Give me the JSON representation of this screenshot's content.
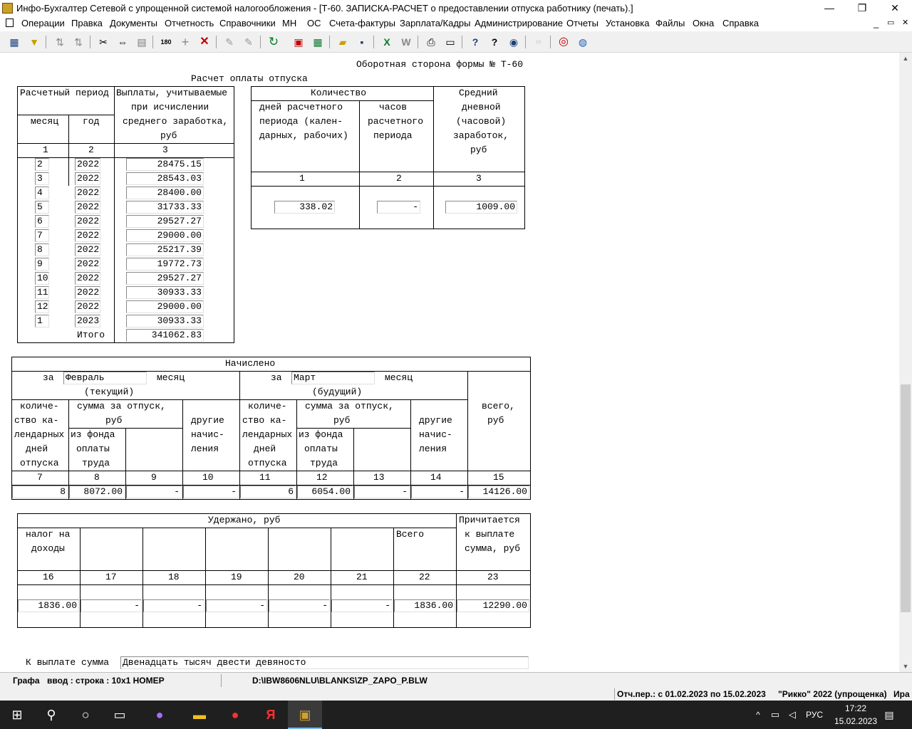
{
  "window": {
    "title": "Инфо-Бухгалтер Сетевой с упрощенной системой налогообложения - [Т-60. ЗАПИСКА-РАСЧЕТ о предоставлении отпуска работнику (печать).]",
    "minimize": "—",
    "restore": "❐",
    "close": "✕"
  },
  "menu": {
    "items": [
      "Операции",
      "Правка",
      "Документы",
      "Отчетность",
      "Справочники",
      "МН",
      "ОС",
      "Счета-фактуры",
      "Зарплата/Кадры",
      "Администрирование",
      "Отчеты",
      "Установка",
      "Файлы",
      "Окна",
      "Справка"
    ],
    "child_min": "_",
    "child_restore": "▭",
    "child_close": "✕"
  },
  "toolbar": {
    "icons": [
      "grid-icon",
      "filter-icon",
      "sort-asc-icon",
      "sort-desc-icon",
      "cut-icon",
      "swap-icon",
      "paste-icon",
      "number-180-icon",
      "add-icon",
      "delete-icon",
      "pin-icon",
      "pin-abc-icon",
      "refresh-icon",
      "calendar-icon",
      "calculator-icon",
      "open-folder-icon",
      "save-icon",
      "excel-icon",
      "word-icon",
      "print-icon",
      "print-preview-icon",
      "help-icon",
      "help-context-icon",
      "compass-icon",
      "report-icon",
      "lifebuoy-icon",
      "globe-icon"
    ]
  },
  "form": {
    "header": "Оборотная сторона формы № Т-60",
    "calc_title": "Расчет оплаты отпуска",
    "left_table": {
      "h_period": "Расчетный период",
      "h_payments": [
        "Выплаты, учитываемые",
        "при исчислении",
        "среднего заработка,",
        "руб"
      ],
      "h_month": "месяц",
      "h_year": "год",
      "col_nums": [
        "1",
        "2",
        "3"
      ],
      "rows": [
        {
          "m": "2",
          "y": "2022",
          "v": "28475.15"
        },
        {
          "m": "3",
          "y": "2022",
          "v": "28543.03"
        },
        {
          "m": "4",
          "y": "2022",
          "v": "28400.00"
        },
        {
          "m": "5",
          "y": "2022",
          "v": "31733.33"
        },
        {
          "m": "6",
          "y": "2022",
          "v": "29527.27"
        },
        {
          "m": "7",
          "y": "2022",
          "v": "29000.00"
        },
        {
          "m": "8",
          "y": "2022",
          "v": "25217.39"
        },
        {
          "m": "9",
          "y": "2022",
          "v": "19772.73"
        },
        {
          "m": "10",
          "y": "2022",
          "v": "29527.27"
        },
        {
          "m": "11",
          "y": "2022",
          "v": "30933.33"
        },
        {
          "m": "12",
          "y": "2022",
          "v": "29000.00"
        },
        {
          "m": "1",
          "y": "2023",
          "v": "30933.33"
        }
      ],
      "total_label": "Итого",
      "total": "341062.83"
    },
    "right_table": {
      "h_qty": "Количество",
      "h_days": [
        "дней расчетного",
        "периода (кален-",
        "дарных, рабочих)"
      ],
      "h_hours": [
        "часов",
        "расчетного",
        "периода"
      ],
      "h_avg": [
        "Средний",
        "дневной",
        "(часовой)",
        "заработок,",
        "руб"
      ],
      "col_nums": [
        "1",
        "2",
        "3"
      ],
      "days": "338.02",
      "hours": "-",
      "avg": "1009.00"
    },
    "accrued": {
      "title": "Начислено",
      "za": "за",
      "month_word": "месяц",
      "cur_month": "Февраль",
      "cur_label": "(текущий)",
      "next_month": "Март",
      "next_label": "(будущий)",
      "h_qty_days": [
        "количе-",
        "ство ка-",
        "лендарных",
        "дней",
        "отпуска"
      ],
      "h_vac_sum": [
        "сумма за отпуск,",
        "руб"
      ],
      "h_fund": [
        "из фонда",
        "оплаты",
        "труда"
      ],
      "h_other": [
        "другие",
        "начис-",
        "ления"
      ],
      "h_total": [
        "всего,",
        "руб"
      ],
      "col_nums": [
        "7",
        "8",
        "9",
        "10",
        "11",
        "12",
        "13",
        "14",
        "15"
      ],
      "values": [
        "8",
        "8072.00",
        "-",
        "-",
        "6",
        "6054.00",
        "-",
        "-",
        "14126.00"
      ]
    },
    "withheld": {
      "title": "Удержано, руб",
      "h_tax": [
        "налог на",
        "доходы"
      ],
      "h_total": "Всего",
      "h_payable": [
        "Причитается",
        "к выплате",
        "сумма, руб"
      ],
      "col_nums": [
        "16",
        "17",
        "18",
        "19",
        "20",
        "21",
        "22",
        "23"
      ],
      "values": [
        "1836.00",
        "-",
        "-",
        "-",
        "-",
        "-",
        "1836.00",
        "12290.00"
      ]
    },
    "payout_label": "К выплате сумма",
    "payout_words": "Двенадцать тысяч двести девяносто"
  },
  "status": {
    "field": "Графа",
    "input": "ввод : строка : 10x1  НОМЕР",
    "path": "D:\\IBW8606NLU\\BLANKS\\ZP_ZAPO_P.BLW",
    "period": "Отч.пер.: с 01.02.2023 по 15.02.2023",
    "org": "\"Рикко\" 2022 (упрощенка)",
    "user": "Ира"
  },
  "taskbar": {
    "lang": "РУС",
    "time": "17:22",
    "date": "15.02.2023"
  }
}
